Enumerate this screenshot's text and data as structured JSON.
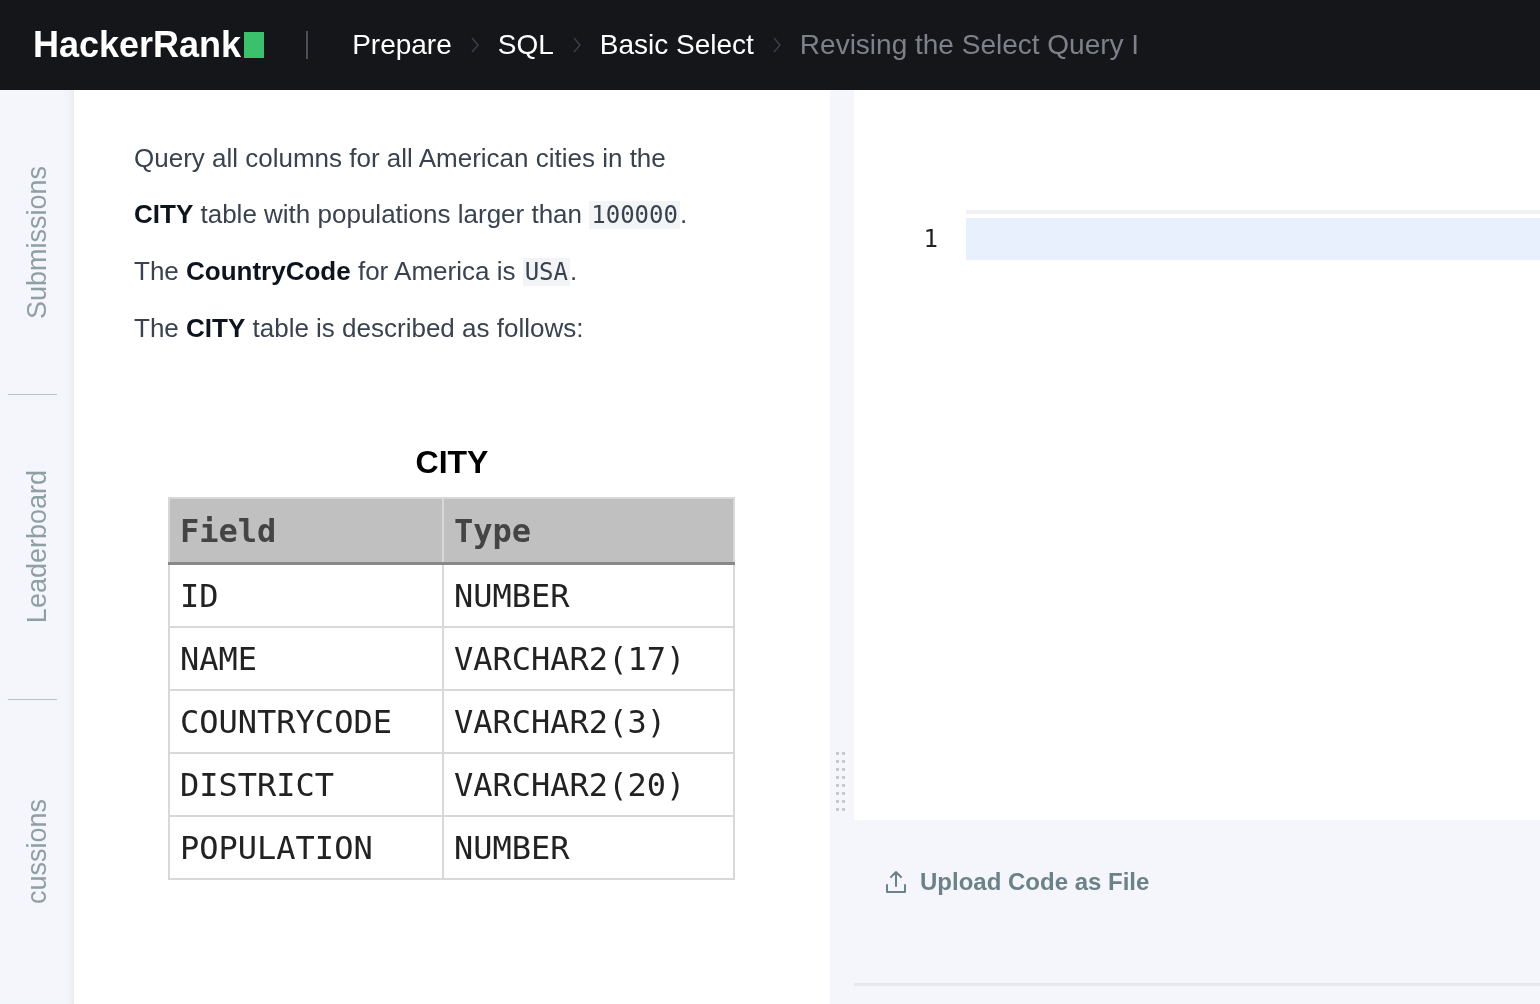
{
  "header": {
    "logo": "HackerRank",
    "breadcrumbs": [
      {
        "label": "Prepare",
        "selected": false
      },
      {
        "label": "SQL",
        "selected": false
      },
      {
        "label": "Basic Select",
        "selected": false
      },
      {
        "label": "Revising the Select Query I",
        "selected": true
      }
    ]
  },
  "sidebar": {
    "tabs": [
      "Submissions",
      "Leaderboard",
      "cussions"
    ]
  },
  "problem": {
    "paragraphs": [
      [
        {
          "kind": "text",
          "text": "Query all columns for all American cities in the"
        }
      ],
      [
        {
          "kind": "text",
          "text": "**CITY** table with populations larger than "
        },
        {
          "kind": "code",
          "text": "100000"
        },
        {
          "kind": "text",
          "text": "."
        }
      ],
      [
        {
          "kind": "text",
          "text": "The **CountryCode** for America is "
        },
        {
          "kind": "code",
          "text": "USA"
        },
        {
          "kind": "text",
          "text": "."
        }
      ],
      [
        {
          "kind": "text",
          "text": "The **CITY** table is described as follows:"
        }
      ]
    ],
    "table": {
      "caption": "CITY",
      "columns": [
        "Field",
        "Type"
      ],
      "rows": [
        [
          "ID",
          "NUMBER"
        ],
        [
          "NAME",
          "VARCHAR2(17)"
        ],
        [
          "COUNTRYCODE",
          "VARCHAR2(3)"
        ],
        [
          "DISTRICT",
          "VARCHAR2(20)"
        ],
        [
          "POPULATION",
          "NUMBER"
        ]
      ]
    }
  },
  "editor": {
    "line_numbers": [
      "1"
    ],
    "upload_label": "Upload Code as File"
  }
}
